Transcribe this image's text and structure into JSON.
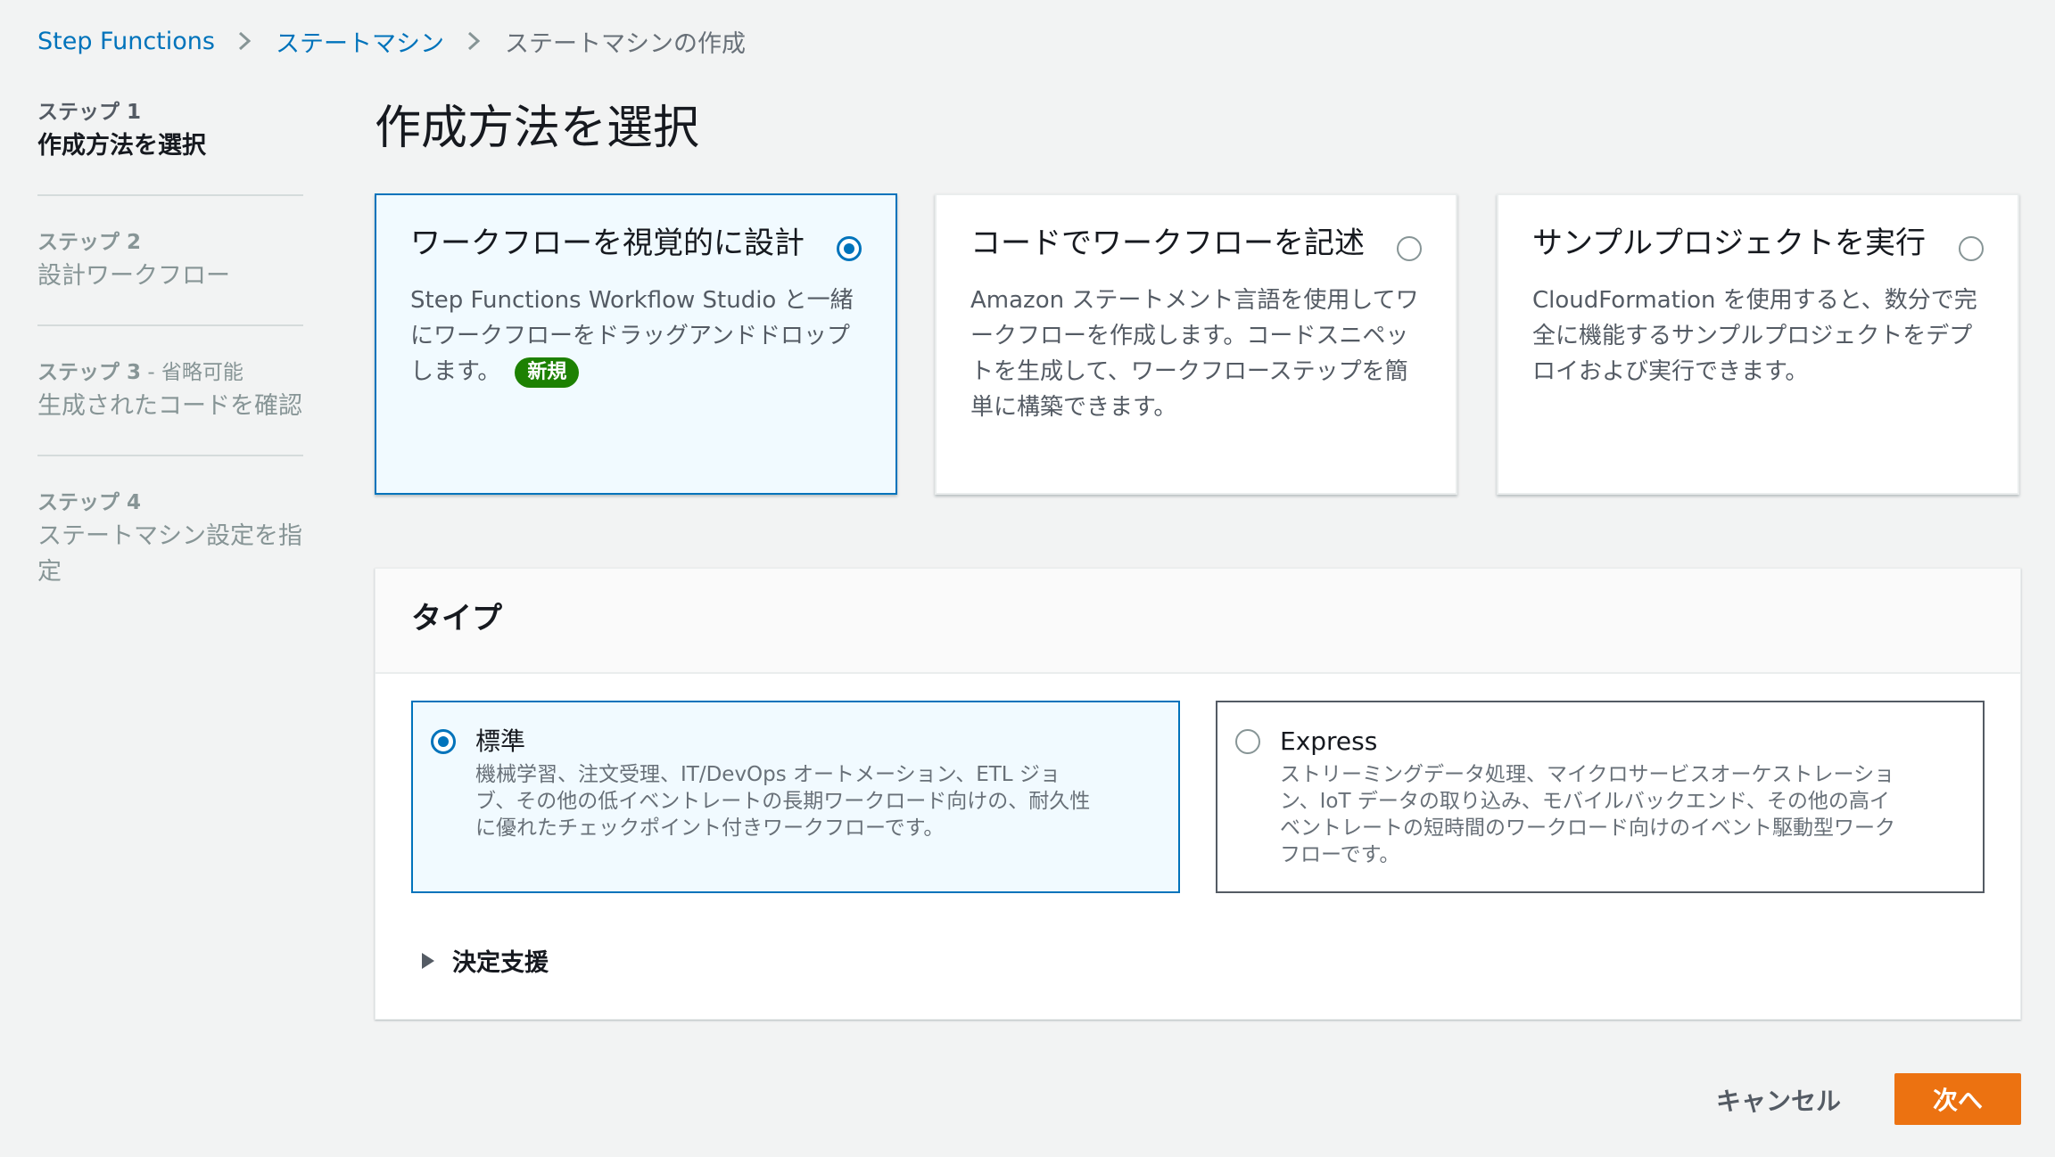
{
  "breadcrumb": {
    "items": [
      {
        "label": "Step Functions"
      },
      {
        "label": "ステートマシン"
      },
      {
        "label": "ステートマシンの作成"
      }
    ]
  },
  "steps": [
    {
      "num": "ステップ 1",
      "optional": "",
      "title": "作成方法を選択"
    },
    {
      "num": "ステップ 2",
      "optional": "",
      "title": "設計ワークフロー"
    },
    {
      "num": "ステップ 3",
      "optional": " - 省略可能",
      "title": "生成されたコードを確認"
    },
    {
      "num": "ステップ 4",
      "optional": "",
      "title": "ステートマシン設定を指定"
    }
  ],
  "page_title": "作成方法を選択",
  "methods": [
    {
      "title": "ワークフローを視覚的に設計",
      "desc": "Step Functions Workflow Studio と一緒にワークフローをドラッグアンドドロップします。",
      "badge": "新規"
    },
    {
      "title": "コードでワークフローを記述",
      "desc": "Amazon ステートメント言語を使用してワークフローを作成します。コードスニペットを生成して、ワークフローステップを簡単に構築できます。"
    },
    {
      "title": "サンプルプロジェクトを実行",
      "desc": "CloudFormation を使用すると、数分で完全に機能するサンプルプロジェクトをデプロイおよび実行できます。"
    }
  ],
  "type_section": {
    "title": "タイプ",
    "options": [
      {
        "label": "標準",
        "desc": "機械学習、注文受理、IT/DevOps オートメーション、ETL ジョブ、その他の低イベントレートの長期ワークロード向けの、耐久性に優れたチェックポイント付きワークフローです。"
      },
      {
        "label": "Express",
        "desc": "ストリーミングデータ処理、マイクロサービスオーケストレーション、IoT データの取り込み、モバイルバックエンド、その他の高イベントレートの短時間のワークロード向けのイベント駆動型ワークフローです。"
      }
    ],
    "help_label": "決定支援"
  },
  "footer": {
    "cancel_label": "キャンセル",
    "next_label": "次へ"
  },
  "colors": {
    "link": "#0073bb",
    "primary_button": "#ec7211",
    "badge": "#1d8102",
    "selected_bg": "#f1faff"
  }
}
